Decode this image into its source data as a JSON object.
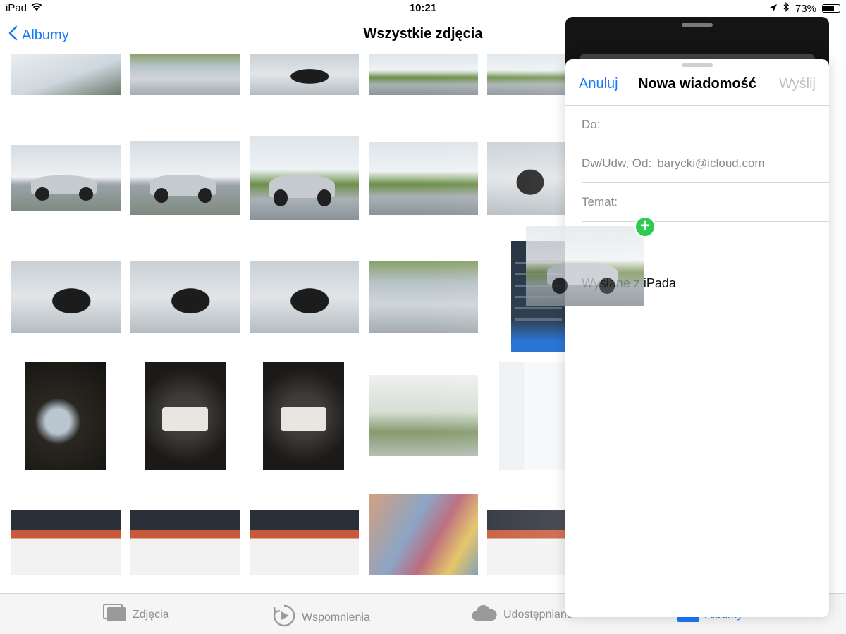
{
  "status": {
    "device": "iPad",
    "time": "10:21",
    "battery_percent": "73%",
    "battery_level": 0.73
  },
  "nav": {
    "back_label": "Albumy",
    "title": "Wszystkie zdjęcia"
  },
  "tabs": [
    {
      "label": "Zdjęcia",
      "icon": "photos-icon"
    },
    {
      "label": "Wspomnienia",
      "icon": "memories-icon"
    },
    {
      "label": "Udostępniane",
      "icon": "cloud-icon"
    },
    {
      "label": "Albumy",
      "icon": "albums-icon"
    }
  ],
  "compose": {
    "cancel_label": "Anuluj",
    "title": "Nowa wiadomość",
    "send_label": "Wyślij",
    "to_label": "Do:",
    "cc_label": "Dw/Udw, Od:",
    "cc_value": "barycki@icloud.com",
    "subject_label": "Temat:",
    "body_text": "Wysłane z iPada"
  },
  "colors": {
    "accent": "#1a7af6",
    "add_badge": "#2ecc4e"
  }
}
